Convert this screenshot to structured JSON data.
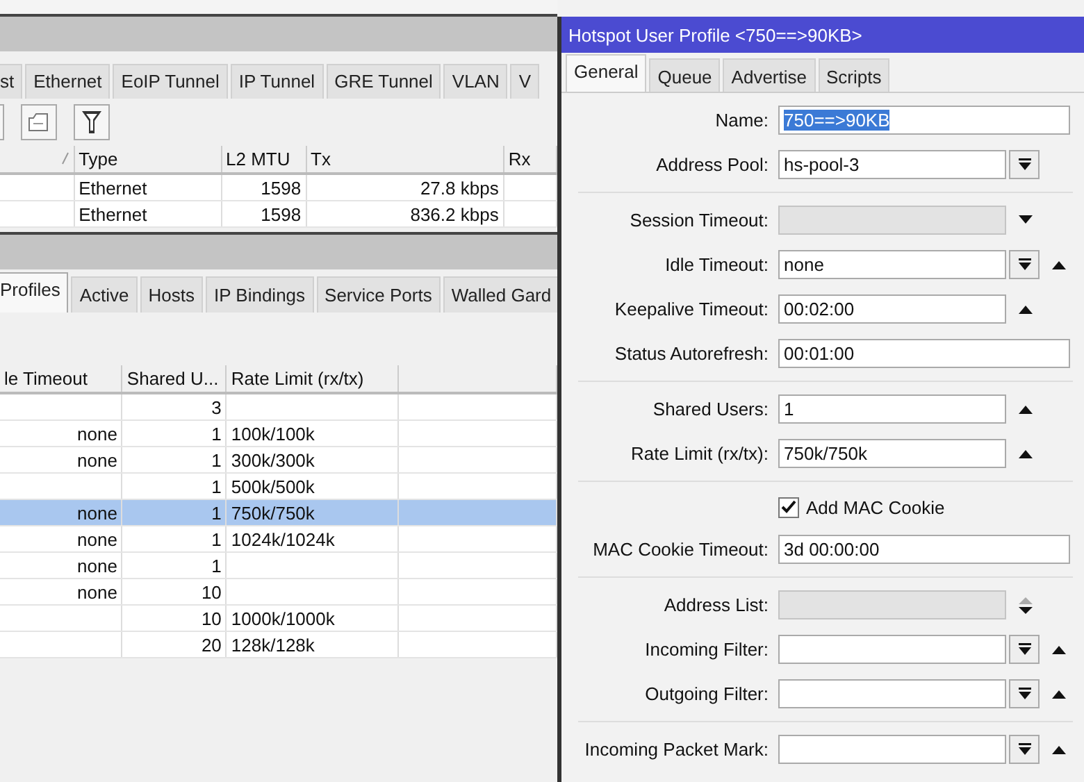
{
  "interfaces_window": {
    "tabs": [
      {
        "label": "st",
        "selected": false
      },
      {
        "label": "Ethernet",
        "selected": false
      },
      {
        "label": "EoIP Tunnel",
        "selected": false
      },
      {
        "label": "IP Tunnel",
        "selected": false
      },
      {
        "label": "GRE Tunnel",
        "selected": false
      },
      {
        "label": "VLAN",
        "selected": false
      },
      {
        "label": "V",
        "selected": false
      }
    ],
    "table": {
      "columns": [
        "Type",
        "L2 MTU",
        "Tx",
        "Rx"
      ],
      "rows": [
        {
          "type": "Ethernet",
          "l2_mtu": "1598",
          "tx": "27.8 kbps"
        },
        {
          "type": "Ethernet",
          "l2_mtu": "1598",
          "tx": "836.2 kbps"
        }
      ]
    }
  },
  "hotspot_window": {
    "tabs": [
      {
        "label": "Profiles",
        "selected": true
      },
      {
        "label": "Active",
        "selected": false
      },
      {
        "label": "Hosts",
        "selected": false
      },
      {
        "label": "IP Bindings",
        "selected": false
      },
      {
        "label": "Service Ports",
        "selected": false
      },
      {
        "label": "Walled Gard",
        "selected": false
      }
    ],
    "table": {
      "columns": [
        "le Timeout",
        "Shared U...",
        "Rate Limit (rx/tx)"
      ],
      "rows": [
        {
          "shared_users": "3",
          "selected": false
        },
        {
          "idle_timeout": "none",
          "shared_users": "1",
          "rate_limit": "100k/100k",
          "selected": false
        },
        {
          "idle_timeout": "none",
          "shared_users": "1",
          "rate_limit": "300k/300k",
          "selected": false
        },
        {
          "shared_users": "1",
          "rate_limit": "500k/500k",
          "selected": false
        },
        {
          "idle_timeout": "none",
          "shared_users": "1",
          "rate_limit": "750k/750k",
          "selected": true
        },
        {
          "idle_timeout": "none",
          "shared_users": "1",
          "rate_limit": "1024k/1024k",
          "selected": false
        },
        {
          "idle_timeout": "none",
          "shared_users": "1",
          "selected": false
        },
        {
          "idle_timeout": "none",
          "shared_users": "10",
          "selected": false
        },
        {
          "shared_users": "10",
          "rate_limit": "1000k/1000k",
          "selected": false
        },
        {
          "shared_users": "20",
          "rate_limit": "128k/128k",
          "selected": false
        }
      ]
    }
  },
  "dialog": {
    "title": "Hotspot User Profile <750==>90KB>",
    "tabs": [
      {
        "label": "General",
        "selected": true
      },
      {
        "label": "Queue",
        "selected": false
      },
      {
        "label": "Advertise",
        "selected": false
      },
      {
        "label": "Scripts",
        "selected": false
      }
    ],
    "form": [
      {
        "kind": "field",
        "label": "Name:",
        "value": "750==>90KB",
        "text_selected": true,
        "disabled": false
      },
      {
        "kind": "field",
        "label": "Address Pool:",
        "value": "hs-pool-3",
        "disabled": false,
        "dropdown": true
      },
      {
        "kind": "separator"
      },
      {
        "kind": "field",
        "label": "Session Timeout:",
        "disabled": true,
        "down_arrow": true
      },
      {
        "kind": "field",
        "label": "Idle Timeout:",
        "value": "none",
        "disabled": false,
        "dropdown": true,
        "up_arrow": true
      },
      {
        "kind": "field",
        "label": "Keepalive Timeout:",
        "value": "00:02:00",
        "disabled": false,
        "up_arrow": true
      },
      {
        "kind": "field",
        "label": "Status Autorefresh:",
        "value": "00:01:00",
        "disabled": false
      },
      {
        "kind": "separator"
      },
      {
        "kind": "field",
        "label": "Shared Users:",
        "value": "1",
        "disabled": false,
        "up_arrow": true
      },
      {
        "kind": "field",
        "label": "Rate Limit (rx/tx):",
        "value": "750k/750k",
        "disabled": false,
        "up_arrow": true
      },
      {
        "kind": "separator"
      },
      {
        "kind": "checkbox",
        "label": "Add MAC Cookie",
        "checked": true
      },
      {
        "kind": "field",
        "label": "MAC Cookie Timeout:",
        "value": "3d 00:00:00",
        "disabled": false
      },
      {
        "kind": "separator"
      },
      {
        "kind": "field",
        "label": "Address List:",
        "disabled": true,
        "up_arrow": true,
        "down_arrow": true
      },
      {
        "kind": "field",
        "label": "Incoming Filter:",
        "disabled": false,
        "dropdown": true,
        "up_arrow": true
      },
      {
        "kind": "field",
        "label": "Outgoing Filter:",
        "disabled": false,
        "dropdown": true,
        "up_arrow": true
      },
      {
        "kind": "separator"
      },
      {
        "kind": "field",
        "label": "Incoming Packet Mark:",
        "disabled": false,
        "dropdown": true,
        "up_arrow": true
      }
    ]
  }
}
